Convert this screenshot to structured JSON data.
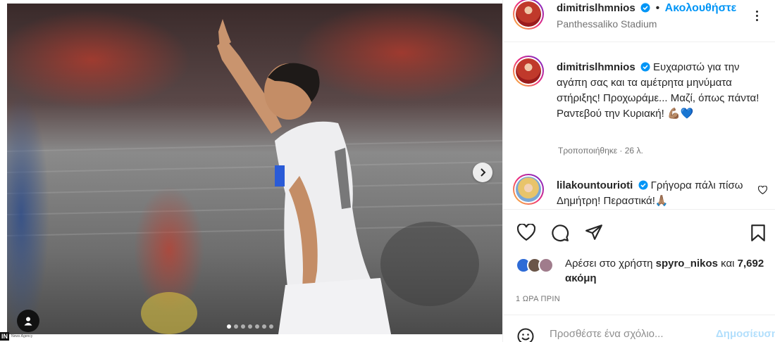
{
  "post": {
    "username": "dimitrislhmnios",
    "follow_label": "Ακολουθήστε",
    "separator": "•",
    "location": "Panthessaliko Stadium",
    "carousel": {
      "total_slides": 7,
      "active_slide": 1
    },
    "photo_badge": {
      "logo": "IN",
      "text": "News Agency"
    }
  },
  "caption": {
    "username": "dimitrislhmnios",
    "text": "Ευχαριστώ για την αγάπη σας και τα αμέτρητα μηνύματα στήριξης! Προχωράμε... Μαζί, όπως πάντα! Ραντεβού την Κυριακή! 💪🏽💙",
    "meta": "Τροποποιήθηκε · 26 λ."
  },
  "comments": [
    {
      "username": "lilakountourioti",
      "text": "Γρήγορα πάλι πίσω Δημήτρη! Περαστικά!🙏🏽"
    }
  ],
  "likes": {
    "prefix": "Αρέσει στο χρήστη",
    "user": "spyro_nikos",
    "and": "και",
    "count": "7,692 ακόμη"
  },
  "timestamp": "1 ΩΡΑ ΠΡΙΝ",
  "add_comment": {
    "placeholder": "Προσθέστε ένα σχόλιο...",
    "post_label": "Δημοσίευση"
  },
  "icons": [
    "verified-badge-icon",
    "more-options-icon",
    "heart-icon",
    "comment-icon",
    "share-icon",
    "bookmark-icon",
    "emoji-icon",
    "tag-user-icon",
    "chevron-right-icon"
  ],
  "colors": {
    "link": "#0095f6",
    "text": "#262626",
    "muted": "#737373",
    "verified": "#0095f6"
  }
}
